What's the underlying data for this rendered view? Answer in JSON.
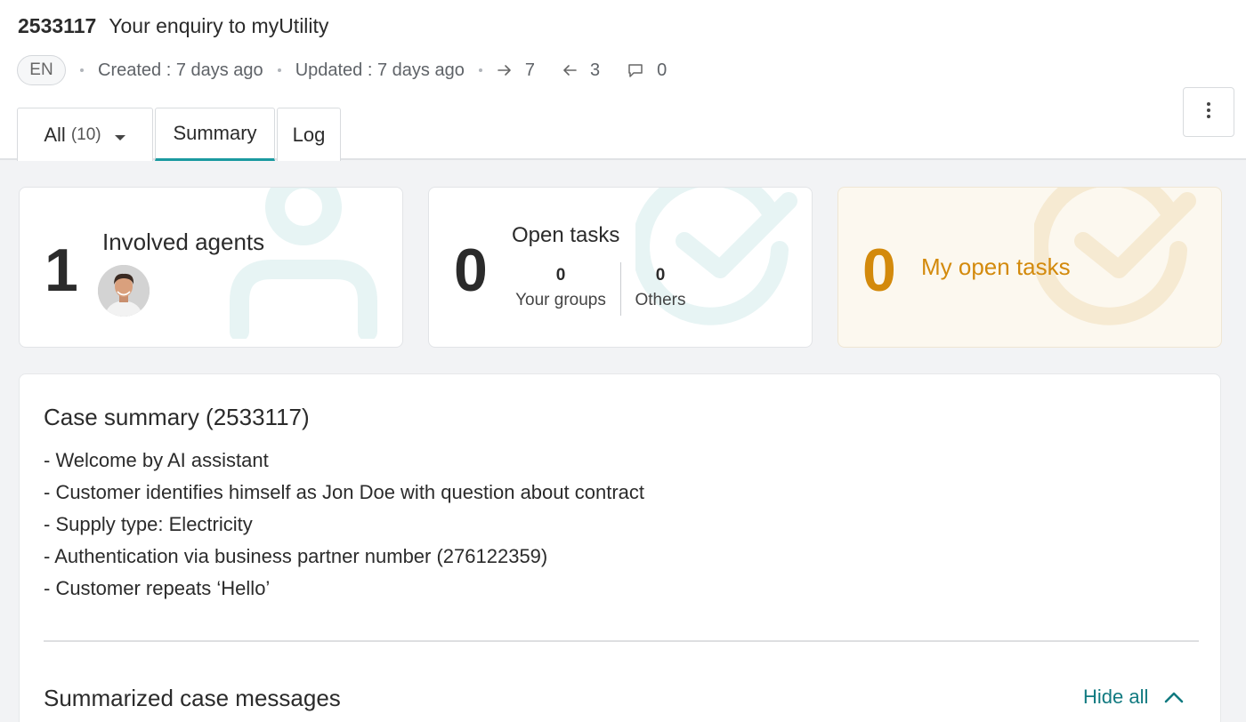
{
  "header": {
    "case_id": "2533117",
    "title": "Your enquiry to myUtility",
    "language": "EN",
    "created": "Created : 7 days ago",
    "updated": "Updated : 7 days ago",
    "outgoing_count": "7",
    "incoming_count": "3",
    "comment_count": "0"
  },
  "tabs": [
    {
      "label": "All",
      "count": "(10)"
    },
    {
      "label": "Summary"
    },
    {
      "label": "Log"
    }
  ],
  "cards": {
    "agents": {
      "value": "1",
      "label": "Involved agents"
    },
    "open_tasks": {
      "value": "0",
      "label": "Open tasks",
      "your_groups_value": "0",
      "your_groups_label": "Your groups",
      "others_value": "0",
      "others_label": "Others"
    },
    "my_open_tasks": {
      "value": "0",
      "label": "My open tasks"
    }
  },
  "summary": {
    "title": "Case summary (2533117)",
    "items": [
      "- Welcome by AI assistant",
      "- Customer identifies himself as Jon Doe with question about contract",
      "- Supply type: Electricity",
      "- Authentication via business partner number (276122359)",
      "- Customer repeats ‘Hello’"
    ],
    "messages_title": "Summarized case messages",
    "hide_all_label": "Hide all"
  },
  "colors": {
    "accent": "#1a9aa0",
    "link": "#117a80",
    "my_tasks_orange": "#d38a0c",
    "my_tasks_bg": "#fcf8ef"
  },
  "icons": {
    "outgoing": "arrow-right-icon",
    "incoming": "arrow-left-icon",
    "comments": "comment-icon",
    "more": "vertical-dots-icon",
    "hide": "chevron-up-icon"
  }
}
